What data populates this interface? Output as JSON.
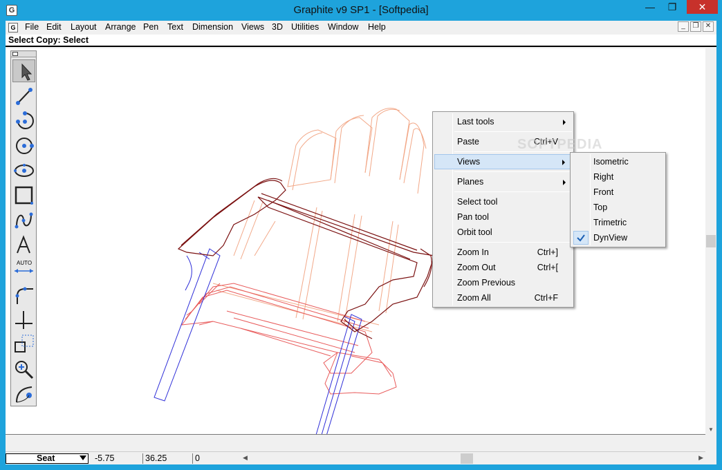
{
  "window": {
    "title": "Graphite v9 SP1 - [Softpedia]",
    "minimize_glyph": "—",
    "maximize_glyph": "❐",
    "close_glyph": "✕"
  },
  "menubar": {
    "items": [
      "File",
      "Edit",
      "Layout",
      "Arrange",
      "Pen",
      "Text",
      "Dimension",
      "Views",
      "3D",
      "Utilities",
      "Window",
      "Help"
    ],
    "mdi_buttons": [
      "_",
      "❐",
      "✕"
    ]
  },
  "prompt": "Select Copy: Select",
  "toolbox": {
    "tools": [
      "select-tool",
      "line-tool",
      "arc-tool",
      "circle-tool",
      "ellipse-tool",
      "rectangle-tool",
      "spline-tool",
      "text-tool",
      "auto-dimension-tool",
      "fillet-tool",
      "construction-line-tool",
      "scale-tool",
      "zoom-tool",
      "rotate-tool"
    ],
    "auto_label": "AUTO"
  },
  "context_menu": {
    "items": [
      {
        "label": "Last tools",
        "submenu": true
      },
      {
        "label": "Paste",
        "shortcut": "Ctrl+V"
      },
      {
        "label": "Views",
        "submenu": true,
        "highlighted": true
      },
      {
        "label": "Planes",
        "submenu": true
      },
      {
        "label": "Select tool"
      },
      {
        "label": "Pan tool"
      },
      {
        "label": "Orbit tool"
      },
      {
        "label": "Zoom In",
        "shortcut": "Ctrl+]"
      },
      {
        "label": "Zoom Out",
        "shortcut": "Ctrl+["
      },
      {
        "label": "Zoom Previous"
      },
      {
        "label": "Zoom All",
        "shortcut": "Ctrl+F"
      }
    ]
  },
  "views_submenu": {
    "items": [
      "Isometric",
      "Right",
      "Front",
      "Top",
      "Trimetric",
      "DynView"
    ],
    "checked": "DynView"
  },
  "watermark": "SOFTPEDIA",
  "bottombar": {
    "layer": "Seat",
    "x": "-5.75",
    "y": "36.25",
    "z": "0"
  },
  "colors": {
    "titlebar": "#1ea3dc",
    "highlight": "#d5e6f7",
    "dark_red": "#7a1010",
    "light_red": "#f0a080",
    "mid_red": "#e05050",
    "blue": "#3030d0"
  }
}
